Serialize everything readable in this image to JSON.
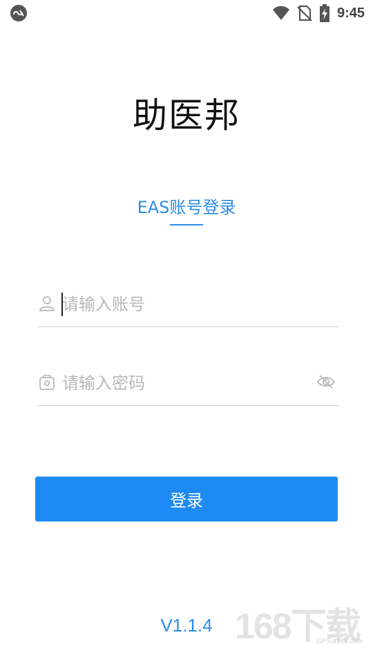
{
  "status_bar": {
    "time": "9:45",
    "left_icon": "app-notification-icon",
    "icons": [
      "wifi-icon",
      "no-sim-icon",
      "battery-charging-icon"
    ]
  },
  "app": {
    "title": "助医邦"
  },
  "login_tab": {
    "label": "EAS账号登录"
  },
  "form": {
    "account": {
      "placeholder": "请输入账号",
      "value": "",
      "icon": "user-icon"
    },
    "password": {
      "placeholder": "请输入密码",
      "value": "",
      "icon": "lock-icon",
      "toggle_icon": "eye-off-icon"
    },
    "submit_label": "登录"
  },
  "footer": {
    "version": "V1.1.4"
  },
  "watermark": {
    "main": "168下载",
    "sub": "GPS.it168.com"
  },
  "colors": {
    "accent": "#2b8de8",
    "button": "#1e8af3",
    "divider": "#cfcfcf",
    "placeholder": "#b8b8b8"
  }
}
